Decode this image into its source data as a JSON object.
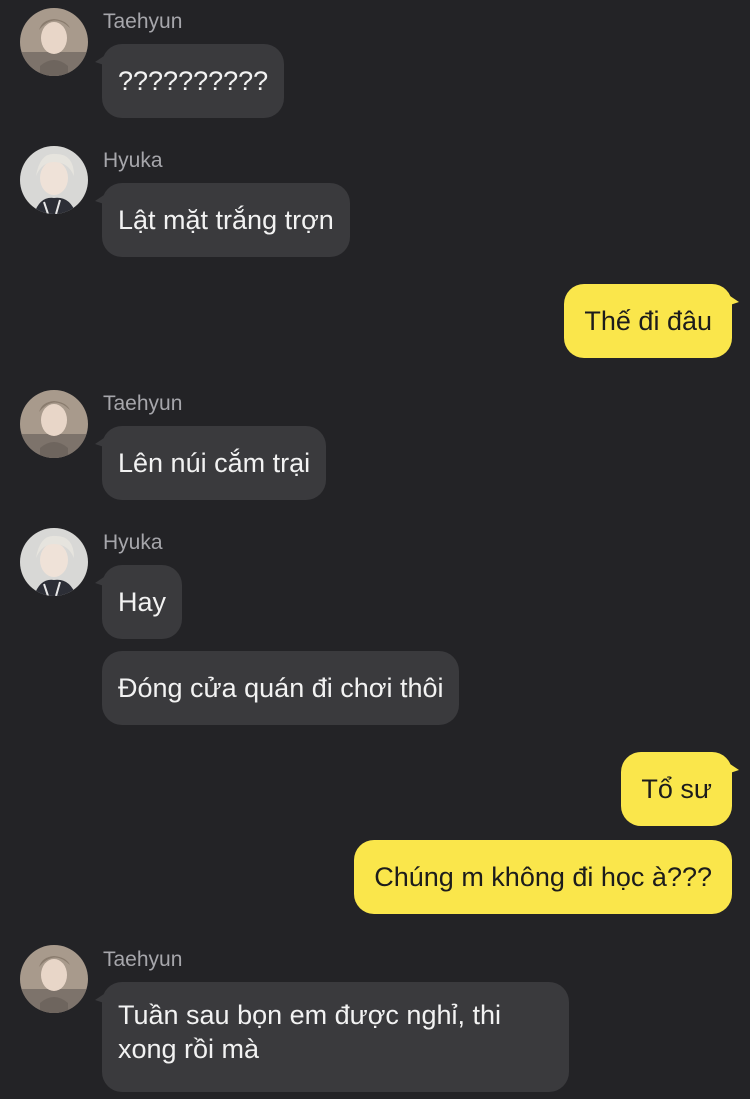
{
  "theme": {
    "background": "#232326",
    "incoming_bubble": "#3a3a3d",
    "outgoing_bubble": "#fae64b",
    "incoming_text": "#f2f2f2",
    "outgoing_text": "#1c1c1c",
    "sender_name": "#a6a6ab"
  },
  "messages": [
    {
      "sender": "Taehyun",
      "avatar": "taehyun-avatar",
      "text": "??????????"
    },
    {
      "sender": "Hyuka",
      "avatar": "hyuka-avatar",
      "text": "Lật mặt trắng trợn"
    },
    {
      "direction": "outgoing",
      "text": "Thế đi đâu"
    },
    {
      "sender": "Taehyun",
      "avatar": "taehyun-avatar",
      "text": "Lên núi cắm trại"
    },
    {
      "sender": "Hyuka",
      "avatar": "hyuka-avatar",
      "text": "Hay"
    },
    {
      "sender": "Hyuka",
      "text": "Đóng cửa quán đi chơi thôi"
    },
    {
      "direction": "outgoing",
      "text": "Tổ sư"
    },
    {
      "direction": "outgoing",
      "text": "Chúng m không đi học à???"
    },
    {
      "sender": "Taehyun",
      "avatar": "taehyun-avatar",
      "lines": [
        "Tuần sau bọn em được nghỉ, thi",
        "xong rồi mà"
      ]
    }
  ]
}
